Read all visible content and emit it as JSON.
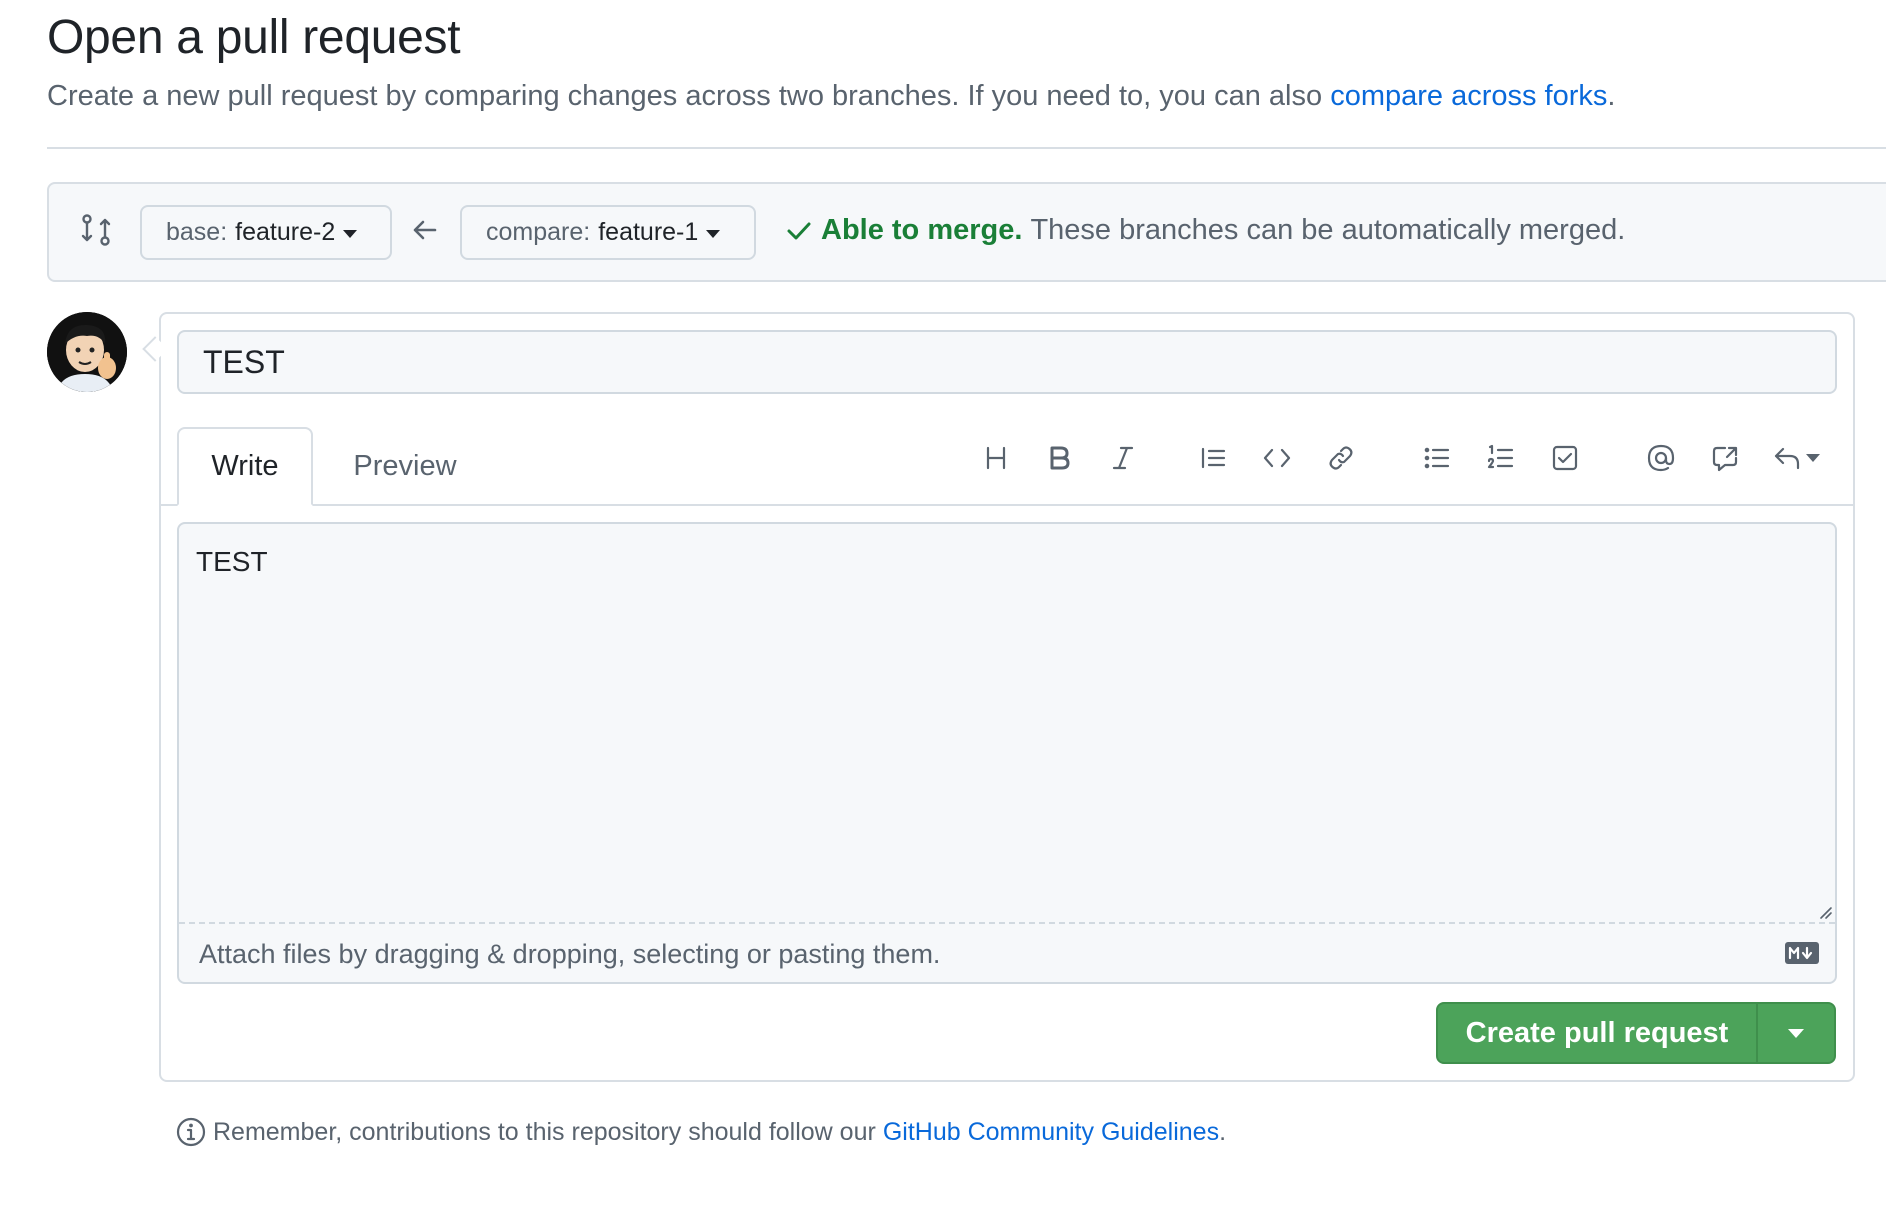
{
  "header": {
    "title": "Open a pull request",
    "subtitle_text": "Create a new pull request by comparing changes across two branches. If you need to, you can also",
    "subtitle_link": "compare across forks",
    "subtitle_end": "."
  },
  "compare": {
    "base_label": "base:",
    "base_branch": "feature-2",
    "compare_label": "compare:",
    "compare_branch": "feature-1",
    "status_ok": "Able to merge.",
    "status_msg": "These branches can be automatically merged.",
    "status_color": "#1a7f37"
  },
  "form": {
    "title_value": "TEST",
    "tabs": [
      {
        "label": "Write",
        "active": true
      },
      {
        "label": "Preview",
        "active": false
      }
    ],
    "toolbar_icons": [
      "heading-icon",
      "bold-icon",
      "italic-icon",
      "quote-icon",
      "code-icon",
      "link-icon",
      "bulleted-list-icon",
      "numbered-list-icon",
      "task-list-icon",
      "mention-icon",
      "cross-reference-icon",
      "saved-reply-icon"
    ],
    "body_value": "TEST",
    "attach_text": "Attach files by dragging & dropping, selecting or pasting them.",
    "submit_label": "Create pull request",
    "submit_color": "#4ca35a"
  },
  "footer": {
    "note_text": "Remember, contributions to this repository should follow our",
    "note_link": "GitHub Community Guidelines",
    "note_end": "."
  }
}
